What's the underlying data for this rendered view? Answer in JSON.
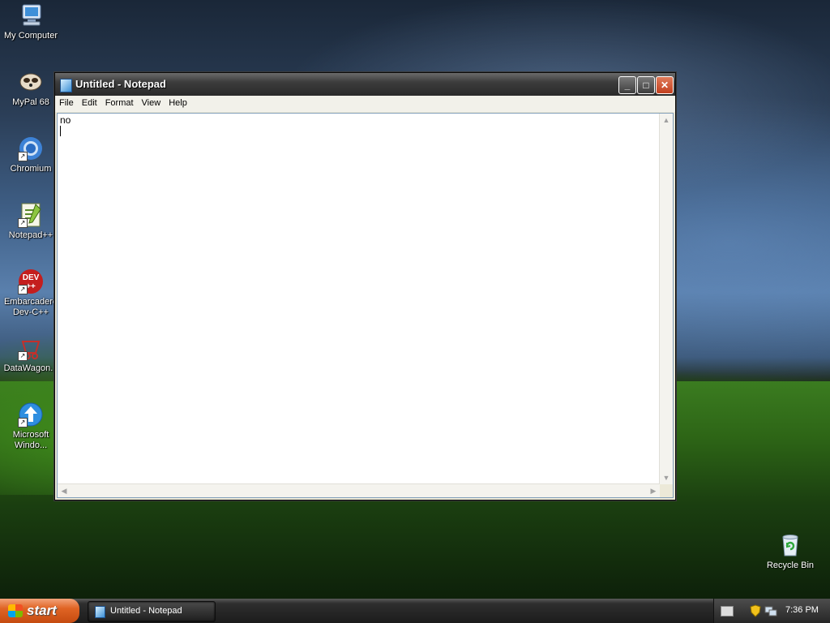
{
  "desktop": {
    "icons": [
      {
        "label": "My Computer",
        "icon": "computer-icon"
      },
      {
        "label": "MyPal 68",
        "icon": "mypal-icon"
      },
      {
        "label": "Chromium",
        "icon": "chromium-icon"
      },
      {
        "label": "Notepad++",
        "icon": "notepadpp-icon"
      },
      {
        "label": "Embarcadero Dev-C++",
        "label_line1": "Embarcadero",
        "label_line2": "Dev-C++",
        "icon": "devcpp-icon"
      },
      {
        "label": "DataWagon...",
        "icon": "datawagon-icon"
      },
      {
        "label": "Microsoft Windo...",
        "label_line1": "Microsoft",
        "label_line2": "Windo...",
        "icon": "windows-update-icon"
      }
    ],
    "recycle_bin": {
      "label": "Recycle Bin",
      "icon": "recycle-bin-icon"
    }
  },
  "window": {
    "title": "Untitled - Notepad",
    "buttons": {
      "minimize": "_",
      "maximize": "□",
      "close": "✕"
    },
    "menu": [
      "File",
      "Edit",
      "Format",
      "View",
      "Help"
    ],
    "content": "no"
  },
  "taskbar": {
    "start_label": "start",
    "task_item": "Untitled - Notepad",
    "clock": "7:36 PM"
  },
  "colors": {
    "start_button": "#e06424",
    "title_bar": "#3c3c3c",
    "close_button": "#c3401e"
  }
}
